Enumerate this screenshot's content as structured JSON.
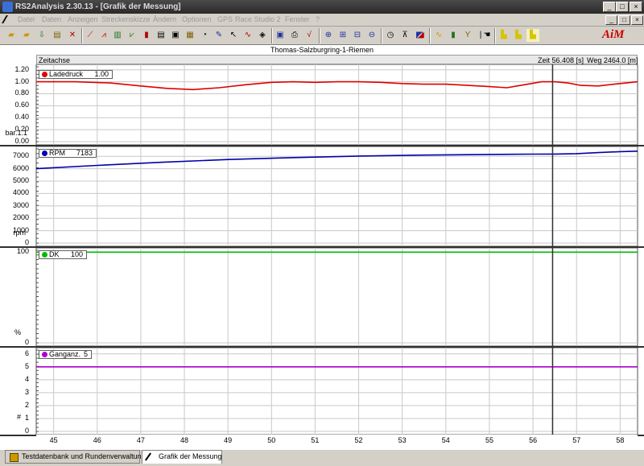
{
  "window": {
    "title": "RS2Analysis 2.30.13 - [Grafik der Messung]",
    "buttons": {
      "minimize": "_",
      "maximize": "□",
      "close": "×"
    }
  },
  "menu": [
    "Datei",
    "Daten",
    "Anzeigen",
    "Streckenskizze",
    "Ändern",
    "Optionen",
    "GPS",
    "Race Studio 2",
    "Fenster",
    "?"
  ],
  "brand": {
    "logo_text": "AiM",
    "color": "#cc0000"
  },
  "session_title": "Thomas-Salzburgring-1-Riemen",
  "header": {
    "axis_label": "Zeitachse",
    "time_readout": "Zeit 56.408 [s]",
    "distance_readout": "Weg 2464.0 [m]"
  },
  "cursor": {
    "time": 56.45
  },
  "x_axis": {
    "ticks": [
      "45",
      "46",
      "47",
      "48",
      "49",
      "50",
      "51",
      "52",
      "53",
      "54",
      "55",
      "56",
      "57",
      "58"
    ],
    "range": [
      44.6,
      58.4
    ]
  },
  "chart_data": [
    {
      "type": "line",
      "name": "Ladedruck",
      "cursor_value": "1.00",
      "unit": "bar.1.1",
      "color": "#dd0000",
      "ylim": [
        0,
        1.25
      ],
      "y_ticks": [
        "1.20",
        "1.00",
        "0.80",
        "0.60",
        "0.40",
        "0.20",
        "0.00"
      ],
      "y_tick_values": [
        1.2,
        1.0,
        0.8,
        0.6,
        0.4,
        0.2,
        0.0
      ],
      "x": [
        44.6,
        45.5,
        46.3,
        47.0,
        47.6,
        48.2,
        48.8,
        49.4,
        50.0,
        50.5,
        51.0,
        51.5,
        52.0,
        52.5,
        53.0,
        53.5,
        54.0,
        54.5,
        55.0,
        55.4,
        55.8,
        56.2,
        56.5,
        56.8,
        57.1,
        57.5,
        58.0,
        58.4
      ],
      "values": [
        1.0,
        1.0,
        0.98,
        0.93,
        0.89,
        0.87,
        0.9,
        0.95,
        0.99,
        1.0,
        0.99,
        1.0,
        1.0,
        0.99,
        0.97,
        0.96,
        0.96,
        0.94,
        0.92,
        0.9,
        0.95,
        1.0,
        1.0,
        0.98,
        0.94,
        0.93,
        0.97,
        1.0
      ]
    },
    {
      "type": "line",
      "name": "RPM",
      "cursor_value": "7183",
      "unit": "rpm",
      "color": "#0000aa",
      "ylim": [
        0,
        7600
      ],
      "y_ticks": [
        "7000",
        "6000",
        "5000",
        "4000",
        "3000",
        "2000",
        "1000",
        "0"
      ],
      "y_tick_values": [
        7000,
        6000,
        5000,
        4000,
        3000,
        2000,
        1000,
        0
      ],
      "x": [
        44.6,
        46.0,
        47.5,
        49.0,
        50.5,
        52.0,
        53.5,
        55.0,
        56.0,
        56.5,
        57.0,
        57.5,
        58.0,
        58.4
      ],
      "values": [
        6000,
        6270,
        6520,
        6740,
        6900,
        7020,
        7100,
        7150,
        7180,
        7183,
        7220,
        7300,
        7380,
        7420
      ]
    },
    {
      "type": "line",
      "name": "DK",
      "cursor_value": "100",
      "unit": "%",
      "color": "#00bb00",
      "ylim": [
        0,
        102
      ],
      "y_ticks": [
        "100",
        "0"
      ],
      "y_tick_values": [
        100,
        0
      ],
      "x": [
        44.6,
        58.4
      ],
      "values": [
        100,
        100
      ]
    },
    {
      "type": "line",
      "name": "Ganganz.",
      "cursor_value": "5",
      "unit": "#",
      "color": "#aa00cc",
      "ylim": [
        0,
        6.3
      ],
      "y_ticks": [
        "6",
        "5",
        "4",
        "3",
        "2",
        "1",
        "0"
      ],
      "y_tick_values": [
        6,
        5,
        4,
        3,
        2,
        1,
        0
      ],
      "x": [
        44.6,
        58.4
      ],
      "values": [
        5,
        5
      ]
    }
  ],
  "tabs": [
    {
      "label": "Testdatenbank und Rundenverwaltung",
      "icon": "database-icon"
    },
    {
      "label": "Grafik der Messung",
      "icon": "pencil-icon"
    }
  ]
}
